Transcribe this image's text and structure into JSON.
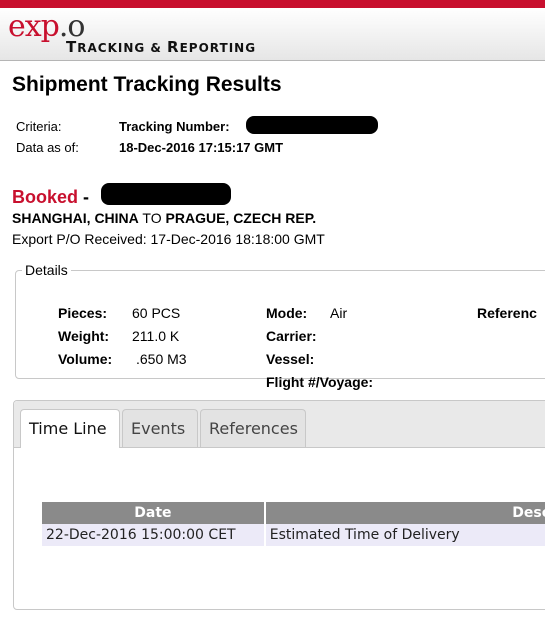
{
  "header": {
    "logo_text": "exp",
    "logo_dot": ".o",
    "subtitle_t": "T",
    "subtitle_1": "RACKING & ",
    "subtitle_r": "R",
    "subtitle_2": "EPORTING",
    "brand_color": "#c8102e"
  },
  "page_title": "Shipment Tracking Results",
  "criteria": {
    "criteria_label": "Criteria:",
    "criteria_value": "Tracking Number:",
    "data_as_of_label": "Data as of:",
    "data_as_of_value": "18-Dec-2016 17:15:17 GMT"
  },
  "shipment": {
    "status": "Booked",
    "separator": "-",
    "origin": "SHANGHAI, CHINA",
    "route_to": "TO",
    "destination": "PRAGUE, CZECH REP.",
    "export_received": "Export P/O Received: 17-Dec-2016 18:18:00 GMT"
  },
  "details": {
    "legend": "Details",
    "pieces_label": "Pieces:",
    "pieces_value": "60 PCS",
    "weight_label": "Weight:",
    "weight_value": "211.0 K",
    "volume_label": "Volume:",
    "volume_value": ".650 M3",
    "mode_label": "Mode:",
    "mode_value": "Air",
    "carrier_label": "Carrier:",
    "vessel_label": "Vessel:",
    "flight_label": "Flight #/Voyage:",
    "reference_label": "Referenc"
  },
  "tabs": [
    {
      "label": "Time Line"
    },
    {
      "label": "Events"
    },
    {
      "label": "References"
    }
  ],
  "timeline": {
    "headers": [
      "Date",
      "Desc"
    ],
    "rows": [
      [
        "22-Dec-2016 15:00:00 CET",
        "Estimated Time of Delivery"
      ]
    ]
  }
}
